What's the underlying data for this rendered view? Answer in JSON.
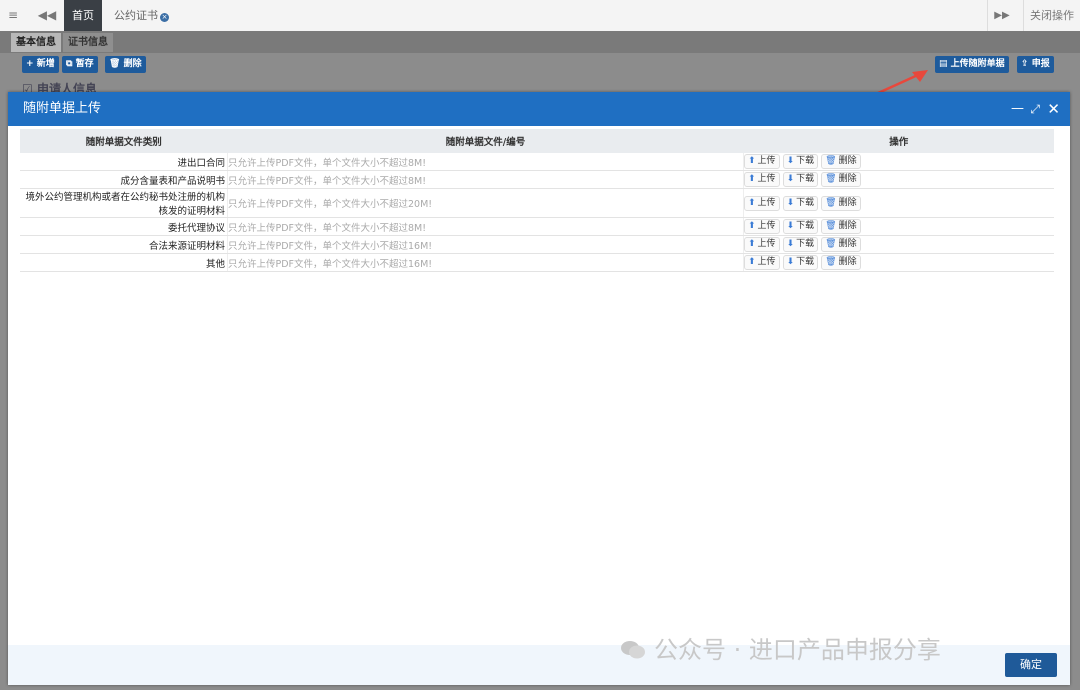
{
  "topbar": {
    "menu_icon": "hamburger-icon",
    "back_icon": "double-left-icon",
    "home_tab": "首页",
    "cert_tab": "公约证书",
    "forward_icon": "double-right-icon",
    "close_ops": "关闭操作"
  },
  "subtabs": [
    "基本信息",
    "证书信息"
  ],
  "toolbar": {
    "add": "新增",
    "save_draft": "暂存",
    "delete": "删除",
    "upload_docs": "上传随附单据",
    "declare": "申报"
  },
  "section_title": "申请人信息",
  "modal": {
    "title": "随附单据上传",
    "columns": [
      "随附单据文件类别",
      "随附单据文件/编号",
      "操作"
    ],
    "rows": [
      {
        "category": "进出口合同",
        "hint": "只允许上传PDF文件，单个文件大小不超过8M!"
      },
      {
        "category": "成分含量表和产品说明书",
        "hint": "只允许上传PDF文件，单个文件大小不超过8M!"
      },
      {
        "category": "境外公约管理机构或者在公约秘书处注册的机构核发的证明材料",
        "hint": "只允许上传PDF文件，单个文件大小不超过20M!"
      },
      {
        "category": "委托代理协议",
        "hint": "只允许上传PDF文件，单个文件大小不超过8M!"
      },
      {
        "category": "合法来源证明材料",
        "hint": "只允许上传PDF文件，单个文件大小不超过16M!"
      },
      {
        "category": "其他",
        "hint": "只允许上传PDF文件，单个文件大小不超过16M!"
      }
    ],
    "op_upload": "上传",
    "op_download": "下载",
    "op_delete": "删除",
    "confirm": "确定"
  },
  "watermark": "公众号 · 进口产品申报分享",
  "colors": {
    "accent": "#1f6fc2",
    "button": "#1e5b9c",
    "arrow": "#e8483c"
  }
}
